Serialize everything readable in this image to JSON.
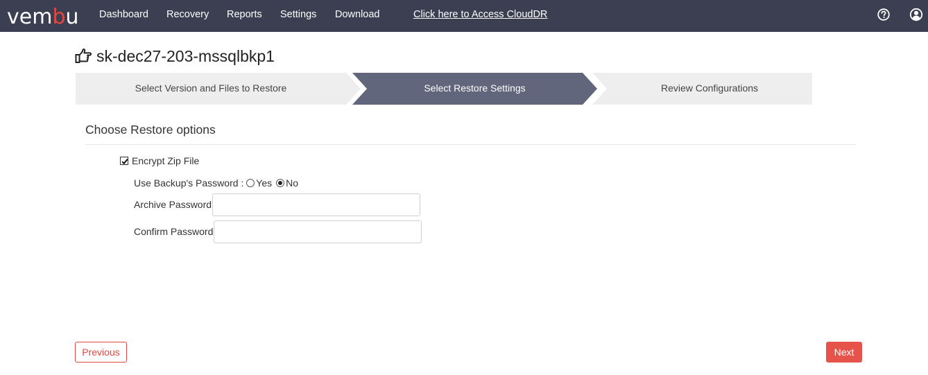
{
  "brand": {
    "logo_text_a": "vem",
    "logo_text_b": "b",
    "logo_text_c": "u",
    "accent_color": "#e5473f",
    "navbar_color": "#3b3f51"
  },
  "nav": {
    "items": [
      "Dashboard",
      "Recovery",
      "Reports",
      "Settings",
      "Download"
    ],
    "cloud_link": "Click here to Access CloudDR",
    "help_icon": "question-circle-icon",
    "user_icon": "user-circle-icon"
  },
  "page": {
    "title": "sk-dec27-203-mssqlbkp1",
    "title_icon": "hand-pointing-right-icon"
  },
  "stepper": {
    "steps": [
      {
        "label": "Select Version and Files to Restore",
        "state": "inactive"
      },
      {
        "label": "Select Restore Settings",
        "state": "active"
      },
      {
        "label": "Review Configurations",
        "state": "inactive"
      }
    ],
    "active_color": "#62667d",
    "inactive_color": "#eeeeee"
  },
  "restore": {
    "section_title": "Choose Restore options",
    "encrypt_label": "Encrypt Zip File",
    "encrypt_checked": true,
    "use_backup_pw_label": "Use Backup's Password :",
    "options": [
      "Yes",
      "No"
    ],
    "selected_option": "No",
    "archive_password_label": "Archive Password",
    "archive_password_value": "",
    "confirm_password_label": "Confirm Password",
    "confirm_password_value": ""
  },
  "buttons": {
    "previous": "Previous",
    "next": "Next"
  }
}
